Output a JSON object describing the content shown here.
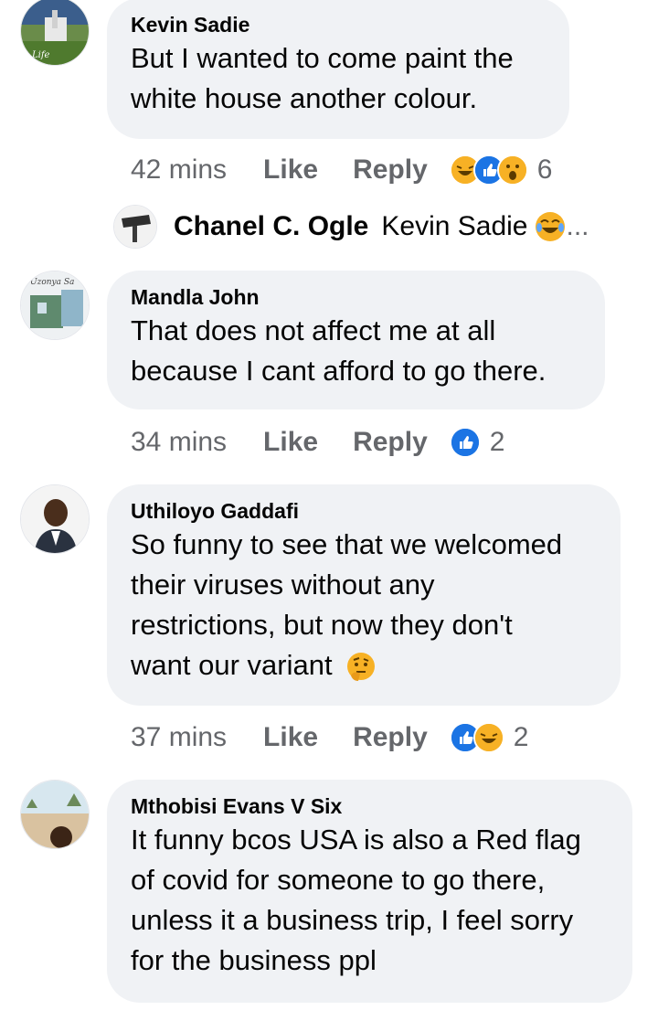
{
  "comments": [
    {
      "author": "Kevin Sadie",
      "lines": [
        "But I wanted to come paint the",
        "white house another colour."
      ],
      "time": "42 mins",
      "like": "Like",
      "reply": "Reply",
      "reactions": [
        "haha",
        "like",
        "wow"
      ],
      "reaction_count": "6"
    },
    {
      "author": "Mandla John",
      "lines": [
        "That does not affect me at all",
        "because I cant afford to go there."
      ],
      "time": "34 mins",
      "like": "Like",
      "reply": "Reply",
      "reactions": [
        "like"
      ],
      "reaction_count": "2"
    },
    {
      "author": "Uthiloyo Gaddafi",
      "lines": [
        "So funny to see that we welcomed",
        "their viruses without any",
        "restrictions, but now they don't",
        "want our variant"
      ],
      "time": "37 mins",
      "like": "Like",
      "reply": "Reply",
      "reactions": [
        "like",
        "haha"
      ],
      "reaction_count": "2"
    },
    {
      "author": "Mthobisi Evans V Six",
      "lines": [
        "It funny bcos USA is also a Red flag",
        "of covid for someone to go there,",
        "unless it a business trip, I feel sorry",
        "for the business ppl"
      ]
    }
  ],
  "reply_preview": {
    "author": "Chanel C. Ogle",
    "text": "Kevin Sadie",
    "ellipsis": "..."
  },
  "colors": {
    "bubble": "#f0f2f5",
    "meta": "#65676b",
    "like_blue": "#1b74e4",
    "emoji_yellow": "#f7b125"
  }
}
